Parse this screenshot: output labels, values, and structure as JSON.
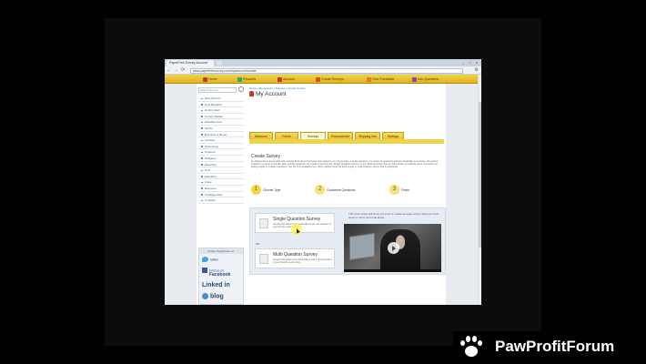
{
  "browser": {
    "tab_title": "PaperFree Survey Account",
    "url": "www.paperfreesurvey.com/myaccount/create",
    "window_controls": "_ □ x",
    "nav_buttons": [
      "←",
      "→",
      "⟳"
    ]
  },
  "site_nav": {
    "items": [
      {
        "label": "Home",
        "icon": "home-icon",
        "color": "#c0392b"
      },
      {
        "label": "Rewards",
        "icon": "rewards-icon",
        "color": "#27ae60"
      },
      {
        "label": "Account",
        "icon": "account-icon",
        "color": "#c0392b"
      },
      {
        "label": "Create Surveys",
        "icon": "create-icon",
        "color": "#d35400"
      },
      {
        "label": "Give Feedback",
        "icon": "feedback-icon",
        "color": "#e67e22"
      },
      {
        "label": "Ask Questions",
        "icon": "question-icon",
        "color": "#8e44ad"
      }
    ]
  },
  "sidebar": {
    "search_placeholder": "Search Survey",
    "menu": [
      "New Account",
      "New Rewards",
      "Getting Start",
      "Current Market",
      "Entertainment",
      "Sports",
      "Business & Money",
      "Lifestyle",
      "Technology",
      "Products",
      "Religious",
      "Parenting",
      "Pets",
      "Education",
      "Cities",
      "Everyone",
      "Uncategorized",
      "Contests"
    ],
    "follow_heading": "Follow PaperFree on:",
    "social": {
      "twitter": "twitter",
      "facebook_small": "Find us on",
      "facebook": "Facebook",
      "linkedin": "Linked in",
      "blog": "blog"
    }
  },
  "main": {
    "breadcrumb": "Home › My Account › Surveys › Create Survey",
    "title": "My Account",
    "tabs": [
      "Welcome",
      "Points",
      "Surveys",
      "Personal Info",
      "Shipping Info",
      "Settings"
    ],
    "active_tab": 2,
    "section_title": "Create Survey",
    "description": "It's always fun to know what other people think about the things that matter to you. If you have a single question or a variety of questions that you would like to examine, the perfect solution is a group of friends. After getting started on the Create & send by the \"Single Question Survey\" or the \"Multi Question Survey\" links below. To add the same of answers for asking single or multiple questions, use the Tool available here. More related points for each single or multi question survey that is supported.",
    "steps": [
      {
        "num": "1",
        "label": "Choose Type"
      },
      {
        "num": "2",
        "label": "Customize Questions"
      },
      {
        "num": "3",
        "label": "Finish"
      }
    ],
    "options": [
      {
        "title": "Single Question Survey",
        "desc": "Choose this option if you would like to ask one question to your friends. Learn more..."
      },
      {
        "title": "Multi Question Survey",
        "desc": "Choose this option if you would like to ask a few questions to your friends. Learn more..."
      }
    ],
    "or_label": "OR",
    "video_caption": "This short video will show you how to create an easy survey with just a few steps in mind, as it's all about..."
  },
  "watermark": {
    "text": "PawProfitForum"
  }
}
